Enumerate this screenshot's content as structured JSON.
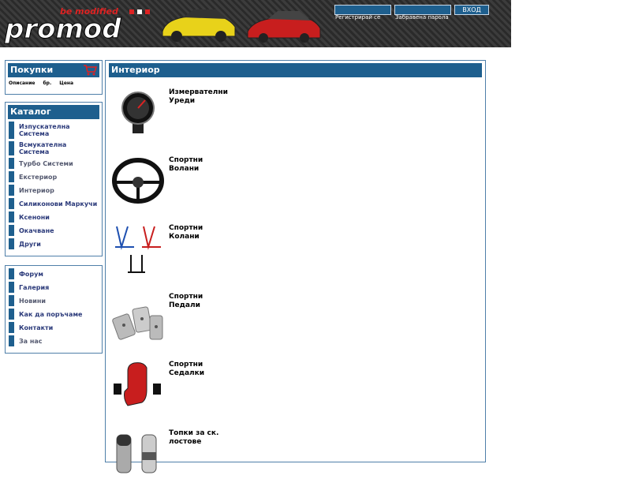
{
  "header": {
    "logo_text": "promod",
    "logo_tagline": "be modified",
    "register_link": "Регистрирай се",
    "forgot_password_link": "Забравена парола",
    "login_button": "ВХОД"
  },
  "cart": {
    "title": "Покупки",
    "columns": [
      "Описание",
      "бр.",
      "Цена"
    ]
  },
  "catalog": {
    "title": "Каталог",
    "items": [
      {
        "label": "Изпускателна Система"
      },
      {
        "label": "Всмукателна Система"
      },
      {
        "label": "Турбо Системи"
      },
      {
        "label": "Екстериор"
      },
      {
        "label": "Интериор"
      },
      {
        "label": "Силиконови Маркучи"
      },
      {
        "label": "Ксенони"
      },
      {
        "label": "Окачване"
      },
      {
        "label": "Други"
      }
    ]
  },
  "menu": {
    "items": [
      {
        "label": "Форум"
      },
      {
        "label": "Галерия"
      },
      {
        "label": "Новини"
      },
      {
        "label": "Как да поръчаме"
      },
      {
        "label": "Контакти"
      },
      {
        "label": "За нас"
      }
    ]
  },
  "main": {
    "title": "Интериор",
    "products": [
      {
        "name": "Измервателни Уреди"
      },
      {
        "name": "Спортни Волани"
      },
      {
        "name": "Спортни Колани"
      },
      {
        "name": "Спортни Педали"
      },
      {
        "name": "Спортни Седалки"
      },
      {
        "name": "Топки за ск. лостове"
      }
    ]
  },
  "colors": {
    "accent": "#1e5f8e",
    "border": "#4f7fa9",
    "link": "#2b3a7a"
  }
}
